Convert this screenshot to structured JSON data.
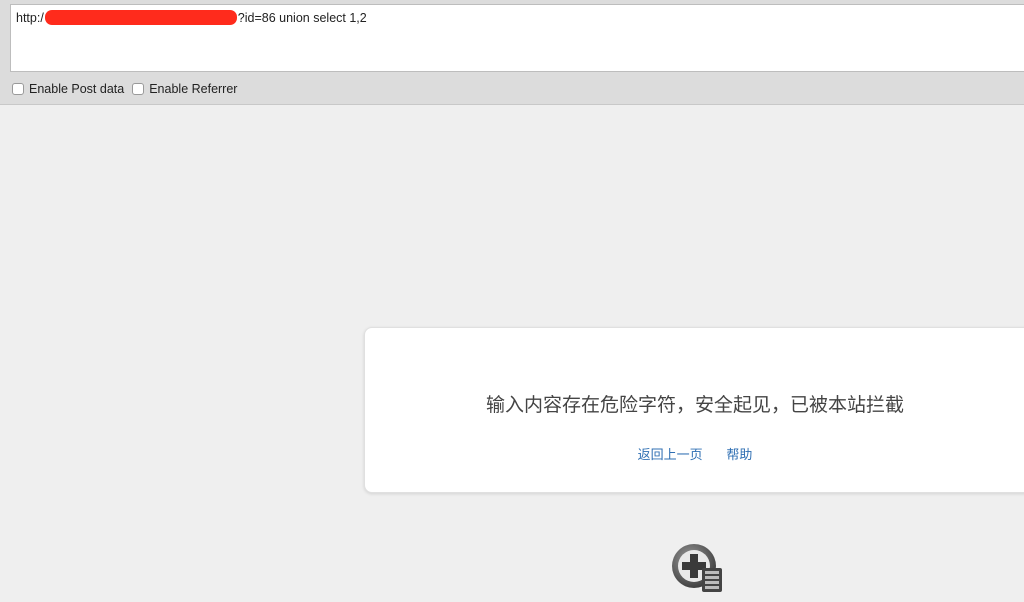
{
  "toolbar": {
    "url_prefix": "http:/",
    "url_suffix": "?id=86 union select 1,2",
    "options": [
      {
        "label": "Enable Post data",
        "checked": false
      },
      {
        "label": "Enable Referrer",
        "checked": false
      }
    ]
  },
  "block_page": {
    "message": "输入内容存在危险字符，安全起见，已被本站拦截",
    "links": [
      "返回上一页",
      "帮助"
    ],
    "logo_icon": "shield-plus-server-icon"
  },
  "colors": {
    "link": "#2f6fb3",
    "redaction": "#ff2b1c",
    "background": "#efefef"
  }
}
